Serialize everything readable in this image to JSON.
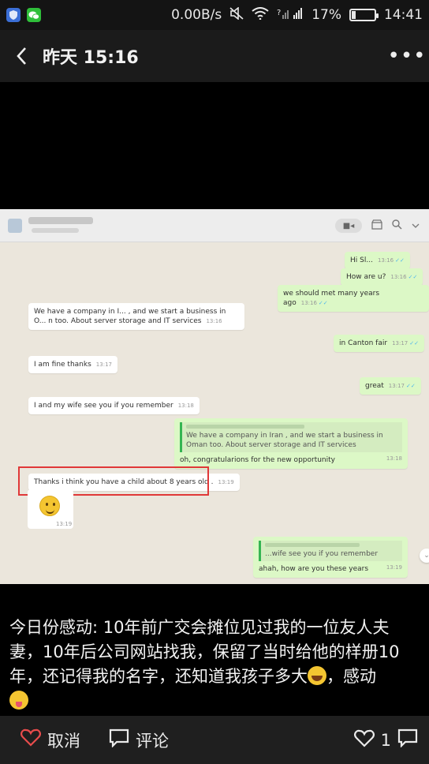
{
  "status_bar": {
    "net_speed": "0.00B/s",
    "battery_pct": "17%",
    "battery_level": 0.17,
    "time": "14:41",
    "icons": [
      "shield-icon",
      "wechat-icon",
      "mute-icon",
      "wifi-icon",
      "signal-icon",
      "battery-icon"
    ]
  },
  "title_bar": {
    "title": "昨天 15:16",
    "back_glyph": "‹",
    "more_glyph": "•••"
  },
  "chat": {
    "messages": [
      {
        "dir": "out",
        "text": "Hi Sl...",
        "time": "13:16"
      },
      {
        "dir": "out",
        "text": "How are u?",
        "time": "13:16"
      },
      {
        "dir": "out",
        "text": "we should met many years ago",
        "time": "13:16"
      },
      {
        "dir": "in",
        "text": "We have a company in I... , and we start a business in O... n too. About server storage and IT services",
        "time": "13:16"
      },
      {
        "dir": "out",
        "text": "in Canton fair",
        "time": "13:17"
      },
      {
        "dir": "in",
        "text": "I am fine thanks",
        "time": "13:17"
      },
      {
        "dir": "out",
        "text": "great",
        "time": "13:17"
      },
      {
        "dir": "in",
        "text": "I and my wife see you if you remember",
        "time": "13:18"
      },
      {
        "dir": "out",
        "quote": "We have a company in Iran , and we start a business in Oman too. About server storage and IT services",
        "text": "oh, congratularions for the new opportunity",
        "time": "13:18"
      },
      {
        "dir": "in",
        "text": "Thanks i think you have a child about 8 years old .",
        "time": "13:19"
      },
      {
        "dir": "in",
        "emoji": "smile",
        "time": "13:19"
      },
      {
        "dir": "out",
        "quote": "...wife see you if you remember",
        "text": "ahah,     how are you these years",
        "time": "13:19"
      }
    ]
  },
  "caption": {
    "text1": "今日份感动: 10年前广交会摊位见过我的一位友人夫妻，10年后公司网站找我，保留了当时给他的样册10年，还记得我的名字，还知道我孩子多大",
    "text2": "，感动"
  },
  "bottom_bar": {
    "cancel_label": "取消",
    "comment_label": "评论",
    "like_count": "1"
  }
}
